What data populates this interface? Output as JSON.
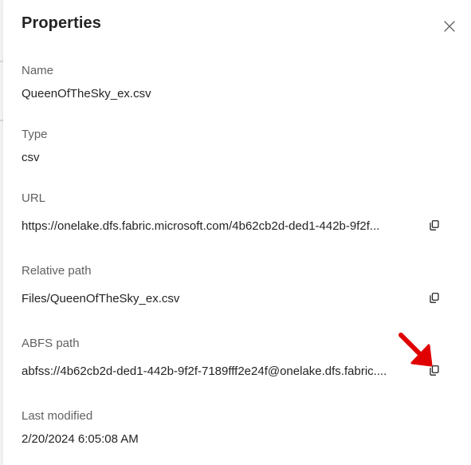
{
  "panel": {
    "title": "Properties",
    "close_icon": "close-icon"
  },
  "fields": {
    "name": {
      "label": "Name",
      "value": "QueenOfTheSky_ex.csv"
    },
    "type": {
      "label": "Type",
      "value": "csv"
    },
    "url": {
      "label": "URL",
      "value": "https://onelake.dfs.fabric.microsoft.com/4b62cb2d-ded1-442b-9f2f...",
      "copy_icon": "copy-icon"
    },
    "relative_path": {
      "label": "Relative path",
      "value": "Files/QueenOfTheSky_ex.csv",
      "copy_icon": "copy-icon"
    },
    "abfs_path": {
      "label": "ABFS path",
      "value": "abfss://4b62cb2d-ded1-442b-9f2f-7189fff2e24f@onelake.dfs.fabric....",
      "copy_icon": "copy-icon"
    },
    "last_modified": {
      "label": "Last modified",
      "value": "2/20/2024 6:05:08 AM"
    }
  },
  "annotation": {
    "icon": "red-arrow-icon",
    "color": "#e00000"
  }
}
